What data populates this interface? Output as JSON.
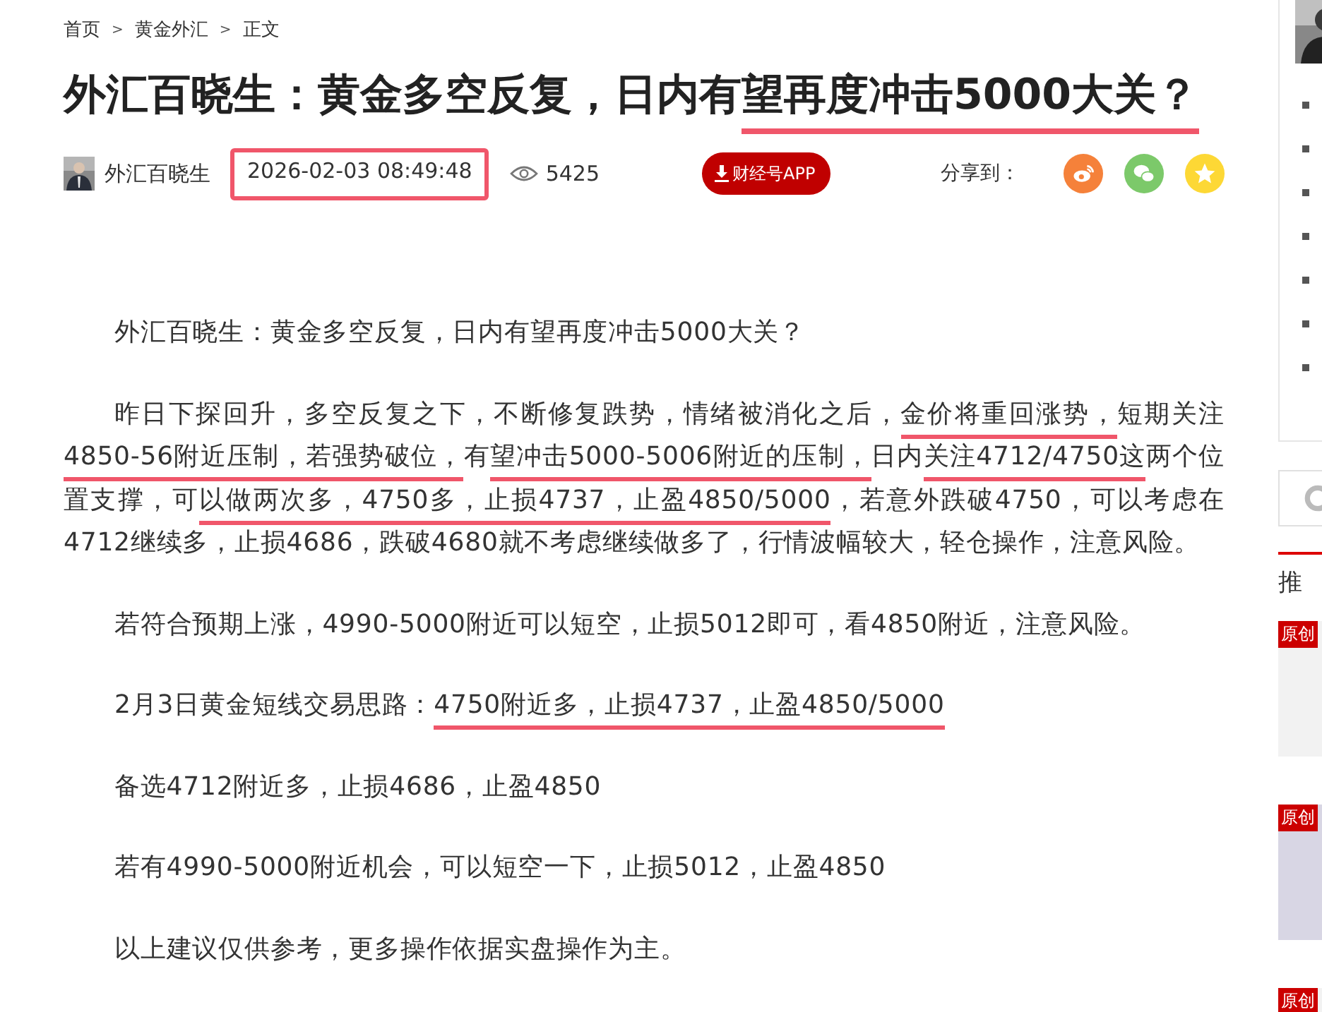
{
  "breadcrumb": [
    "首页",
    "黄金外汇",
    "正文"
  ],
  "breadcrumb_separator": ">",
  "title": [
    {
      "text": "外汇百晓生：黄金多空反复，日内有",
      "underlined": false
    },
    {
      "text": "望再度冲击5000大关？",
      "underlined": true
    }
  ],
  "meta": {
    "author": "外汇百晓生",
    "date": {
      "text": "2026-02-03 08:49:48",
      "boxed": true
    },
    "views": "5425",
    "app_button": "财经号APP",
    "share_label": "分享到：",
    "share_icons": [
      {
        "kind": "weibo"
      },
      {
        "kind": "wechat"
      },
      {
        "kind": "qzone"
      }
    ]
  },
  "paragraphs": [
    [
      {
        "text": "外汇百晓生：黄金多空反复，日内有望再度冲击5000大关？",
        "underlined": false
      }
    ],
    [
      {
        "text": "昨日下探回升，多空反复之下，不断修复跌势，情绪被消化之后，",
        "underlined": false
      },
      {
        "text": "金价将重回涨势，",
        "underlined": true
      },
      {
        "text": "短期关注",
        "underlined": false
      },
      {
        "text": "4850-56附近压制，若强势破位，",
        "underlined": true
      },
      {
        "text": "有",
        "underlined": false
      },
      {
        "text": "望冲击5000-5006附近的压制，",
        "underlined": true
      },
      {
        "text": "日内",
        "underlined": false
      },
      {
        "text": "关注4712/4750这",
        "underlined": true
      },
      {
        "text": "两个位置支撑，可",
        "underlined": false
      },
      {
        "text": "以做两次多，4750多，止损4737，止盈4850/5000",
        "underlined": true
      },
      {
        "text": "，若意外跌破4750，可以考虑在4712继续多，止损4686，跌破4680就不考虑继续做多了，行情波幅较大，轻仓操作，注意风险。",
        "underlined": false
      }
    ],
    [
      {
        "text": "若符合预期上涨，4990-5000附近可以短空，止损5012即可，看4850附近，注意风险。",
        "underlined": false
      }
    ],
    [
      {
        "text": "2月3日黄金短线交易思路：",
        "underlined": false
      },
      {
        "text": "4750附近多，止损4737，止盈4850/5000",
        "underlined": true
      }
    ],
    [
      {
        "text": "备选4712附近多，止损4686，止盈4850",
        "underlined": false
      }
    ],
    [
      {
        "text": "若有4990-5000附近机会，可以短空一下，止损5012，止盈4850",
        "underlined": false
      }
    ],
    [
      {
        "text": "以上建议仅供参考，更多操作依据实盘操作为主。",
        "underlined": false
      }
    ]
  ],
  "sidebar": {
    "heading": "推",
    "badges": [
      "原创",
      "原创",
      "原创"
    ]
  }
}
